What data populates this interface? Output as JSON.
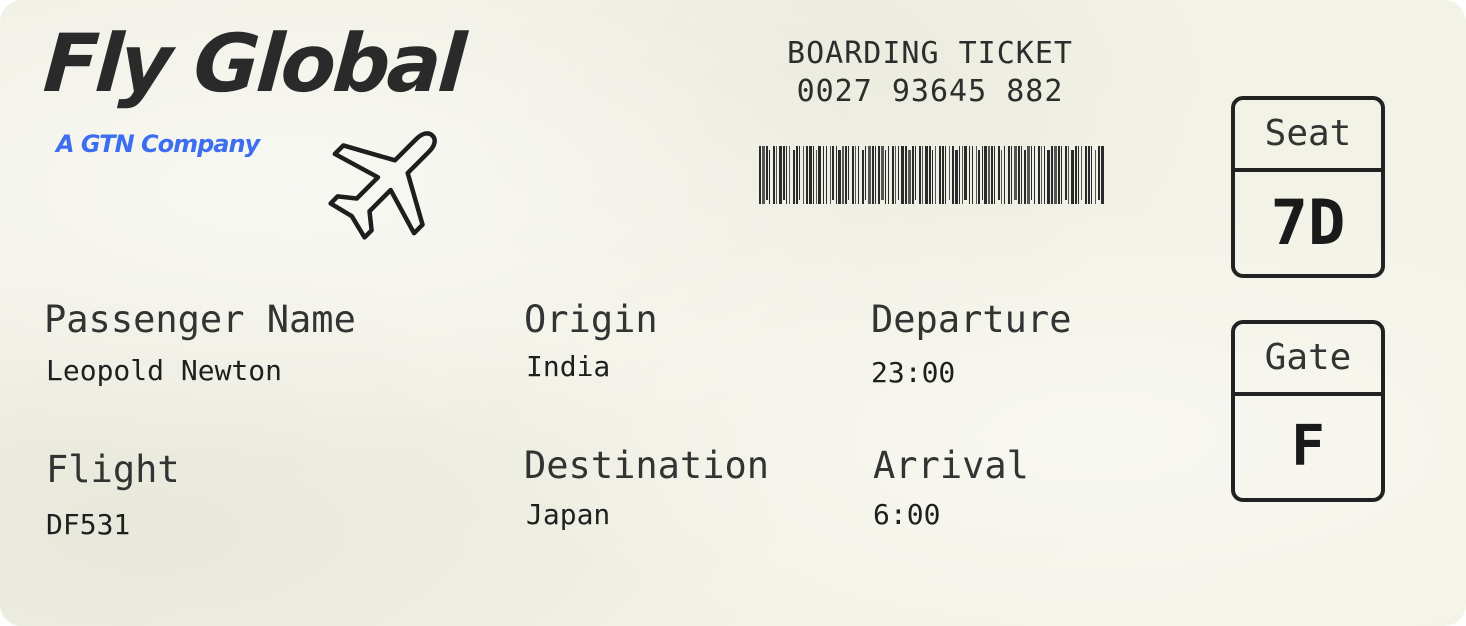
{
  "brand": {
    "name": "Fly Global",
    "tagline": "A GTN Company",
    "accent_color": "#3d6ef0",
    "text_color": "#2a2a2a"
  },
  "ticket": {
    "type": "BOARDING TICKET",
    "number": "0027 93645 882",
    "background_color": "#f3f3e8"
  },
  "icons": {
    "plane": "airplane-icon",
    "barcode": "barcode"
  },
  "fields": {
    "passenger_name": {
      "label": "Passenger Name",
      "value": "Leopold Newton"
    },
    "origin": {
      "label": "Origin",
      "value": "India"
    },
    "departure": {
      "label": "Departure",
      "value": "23:00"
    },
    "flight": {
      "label": "Flight",
      "value": "DF531"
    },
    "destination": {
      "label": "Destination",
      "value": "Japan"
    },
    "arrival": {
      "label": "Arrival",
      "value": "6:00"
    }
  },
  "seat": {
    "label": "Seat",
    "value": "7D"
  },
  "gate": {
    "label": "Gate",
    "value": "F"
  }
}
